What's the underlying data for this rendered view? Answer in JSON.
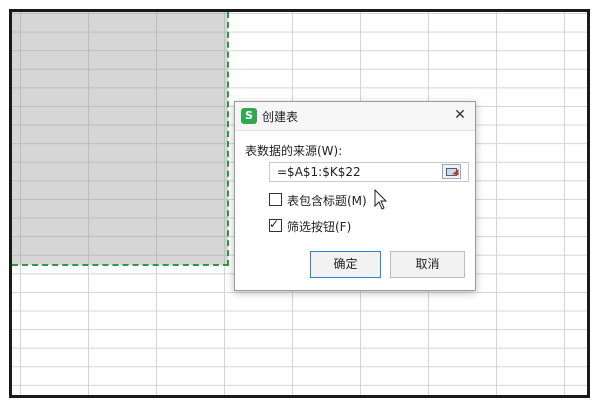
{
  "dialog": {
    "title": "创建表",
    "app_icon": "S",
    "close_glyph": "✕",
    "source_label": "表数据的来源(W):",
    "range_value": "=$A$1:$K$22",
    "checkboxes": [
      {
        "label": "表包含标题(M)",
        "checked": false
      },
      {
        "label": "筛选按钮(F)",
        "checked": true
      }
    ],
    "ok_label": "确定",
    "cancel_label": "取消"
  },
  "colors": {
    "selection_fill": "#d6d6d6",
    "marquee": "#2e9a3f",
    "app_icon": "#2fa94f",
    "ok_border": "#2f7fd4"
  },
  "icons": [
    "app-icon",
    "close-icon",
    "range-select-icon",
    "mouse-pointer-icon"
  ]
}
